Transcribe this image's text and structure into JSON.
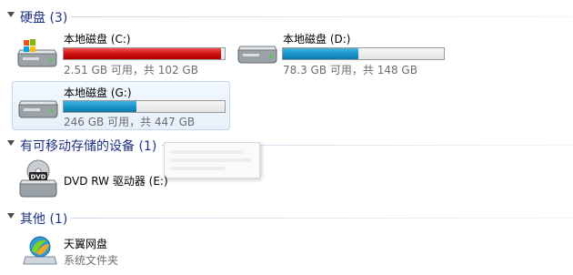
{
  "groups": {
    "hard_disks": {
      "title": "硬盘 (3)"
    },
    "removable": {
      "title": "有可移动存储的设备 (1)"
    },
    "other": {
      "title": "其他 (1)"
    }
  },
  "drives": [
    {
      "name": "本地磁盘 (C:)",
      "usage": "2.51 GB 可用，共 102 GB",
      "used_fraction": 0.975,
      "bar_color": "#cc0e0e"
    },
    {
      "name": "本地磁盘 (D:)",
      "usage": "78.3 GB 可用，共 148 GB",
      "used_fraction": 0.47,
      "bar_color": "#1893c9"
    },
    {
      "name": "本地磁盘 (G:)",
      "usage": "246 GB 可用，共 447 GB",
      "used_fraction": 0.45,
      "bar_color": "#1893c9"
    }
  ],
  "removable_devices": [
    {
      "name": "DVD RW 驱动器 (E:)",
      "icon": "dvd-drive-icon",
      "disc_label": "DVD"
    }
  ],
  "other_items": [
    {
      "name": "天翼网盘",
      "subtitle": "系统文件夹",
      "icon": "cloud-drive-icon"
    }
  ]
}
